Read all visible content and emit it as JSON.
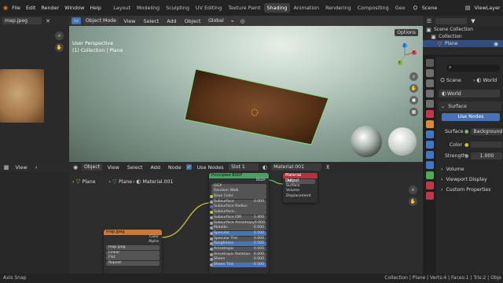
{
  "topbar": {
    "menus": [
      "File",
      "Edit",
      "Render",
      "Window",
      "Help"
    ],
    "workspaces": [
      "Layout",
      "Modeling",
      "Sculpting",
      "UV Editing",
      "Texture Paint",
      "Shading",
      "Animation",
      "Rendering",
      "Compositing",
      "Geo"
    ],
    "active_workspace": "Shading",
    "scene": "Scene",
    "view_layer": "ViewLayer"
  },
  "image_editor": {
    "filename": "map.jpeg",
    "view": "View"
  },
  "viewport": {
    "mode": "Object Mode",
    "menus": [
      "View",
      "Select",
      "Add",
      "Object"
    ],
    "orientation": "Global",
    "overlay_title": "User Perspective",
    "overlay_sub": "(1) Collection | Plane",
    "options": "Options",
    "axes": {
      "x": "X",
      "y": "Y",
      "z": "Z"
    }
  },
  "node_editor": {
    "type": "Object",
    "menus": [
      "View",
      "Select",
      "Add",
      "Node"
    ],
    "use_nodes": "Use Nodes",
    "slot": "Slot 1",
    "material": "Material.001",
    "breadcrumb": [
      "Plane",
      "Plane",
      "Material.001"
    ]
  },
  "nodes": {
    "principled": {
      "title": "Principled BSDF",
      "out": "BSDF",
      "dist": "GGX",
      "sss": "Random Walk",
      "rows": [
        [
          "Base Color",
          ""
        ],
        [
          "Subsurface",
          "0.000"
        ],
        [
          "Subsurface Radius",
          ""
        ],
        [
          "Subsurface...",
          ""
        ],
        [
          "Subsurface IOR",
          "1.400"
        ],
        [
          "Subsurface Anisotropy",
          "0.000"
        ],
        [
          "Metallic",
          "0.000"
        ],
        [
          "Specular",
          "0.500"
        ],
        [
          "Specular Tint",
          "0.000"
        ],
        [
          "Roughness",
          "0.500"
        ],
        [
          "Anisotropic",
          "0.000"
        ],
        [
          "Anisotropic Rotation",
          "0.000"
        ],
        [
          "Sheen",
          "0.000"
        ],
        [
          "Sheen Tint",
          "0.500"
        ]
      ]
    },
    "output": {
      "title": "Material Output",
      "target": "All",
      "rows": [
        "Surface",
        "Volume",
        "Displacement"
      ]
    },
    "image": {
      "title": "map.jpeg",
      "outs": [
        "Color",
        "Alpha"
      ],
      "file": "map.jpeg",
      "opts": [
        "Linear",
        "Flat",
        "Repeat"
      ]
    }
  },
  "outliner": {
    "scene_collection": "Scene Collection",
    "collection": "Collection",
    "plane": "Plane"
  },
  "properties": {
    "breadcrumb": [
      "Scene",
      "World"
    ],
    "world": "World",
    "surface": "Surface",
    "use_nodes": "Use Nodes",
    "surface_label": "Surface",
    "surface_value": "Background",
    "color_label": "Color",
    "strength_label": "Strength",
    "strength_value": "1.000",
    "sections": [
      "Volume",
      "Viewport Display",
      "Custom Properties"
    ]
  },
  "status": {
    "left": "Axis Snap",
    "right": "Collection | Plane | Verts:4 | Faces:1 | Tris:2 | Obje"
  }
}
